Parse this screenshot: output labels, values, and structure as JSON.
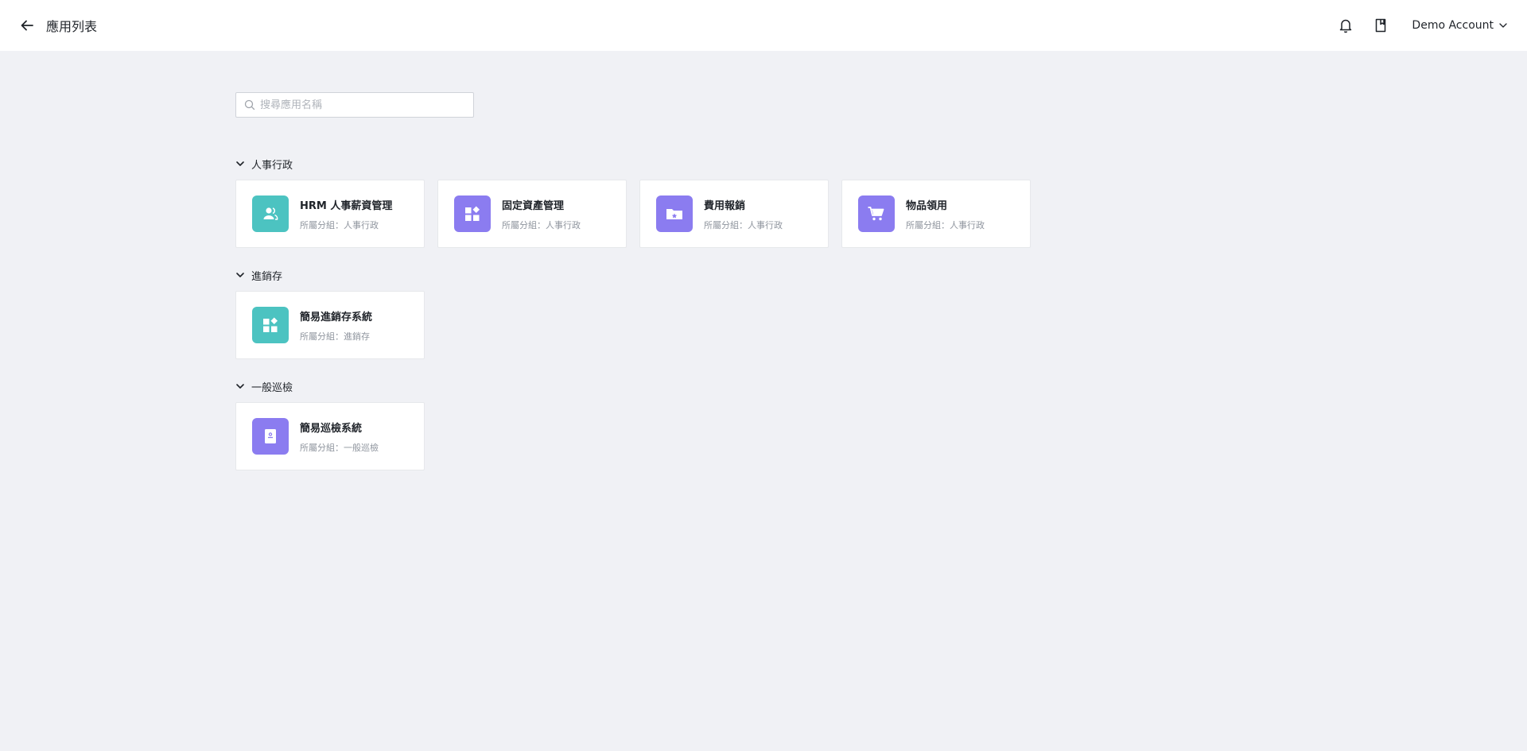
{
  "header": {
    "title": "應用列表",
    "account_name": "Demo Account"
  },
  "search": {
    "placeholder": "搜尋應用名稱",
    "value": ""
  },
  "colors": {
    "teal": "#4cc3c1",
    "purple": "#8b7cf0",
    "background": "#f0f1f5"
  },
  "groups": [
    {
      "title": "人事行政",
      "apps": [
        {
          "name": "HRM 人事薪資管理",
          "group_label": "所屬分組：人事行政",
          "icon": "user-group-icon",
          "color": "#4cc3c1"
        },
        {
          "name": "固定資產管理",
          "group_label": "所屬分組：人事行政",
          "icon": "widgets-icon",
          "color": "#8b7cf0"
        },
        {
          "name": "費用報銷",
          "group_label": "所屬分組：人事行政",
          "icon": "folder-icon",
          "color": "#8b7cf0"
        },
        {
          "name": "物品領用",
          "group_label": "所屬分組：人事行政",
          "icon": "cart-icon",
          "color": "#8b7cf0"
        }
      ]
    },
    {
      "title": "進銷存",
      "apps": [
        {
          "name": "簡易進銷存系統",
          "group_label": "所屬分組：進銷存",
          "icon": "widgets-icon",
          "color": "#4cc3c1"
        }
      ]
    },
    {
      "title": "一般巡檢",
      "apps": [
        {
          "name": "簡易巡檢系統",
          "group_label": "所屬分組：一般巡檢",
          "icon": "clipboard-icon",
          "color": "#8b7cf0"
        }
      ]
    }
  ]
}
